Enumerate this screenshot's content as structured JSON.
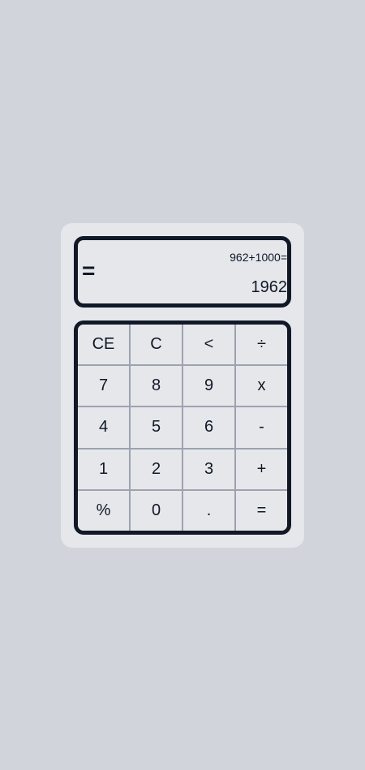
{
  "display": {
    "equals_icon": "=",
    "expression": "962+1000=",
    "result": "1962"
  },
  "keys": {
    "ce": "CE",
    "c": "C",
    "backspace": "<",
    "divide": "÷",
    "seven": "7",
    "eight": "8",
    "nine": "9",
    "multiply": "x",
    "four": "4",
    "five": "5",
    "six": "6",
    "subtract": "-",
    "one": "1",
    "two": "2",
    "three": "3",
    "add": "+",
    "percent": "%",
    "zero": "0",
    "decimal": ".",
    "equals": "="
  }
}
